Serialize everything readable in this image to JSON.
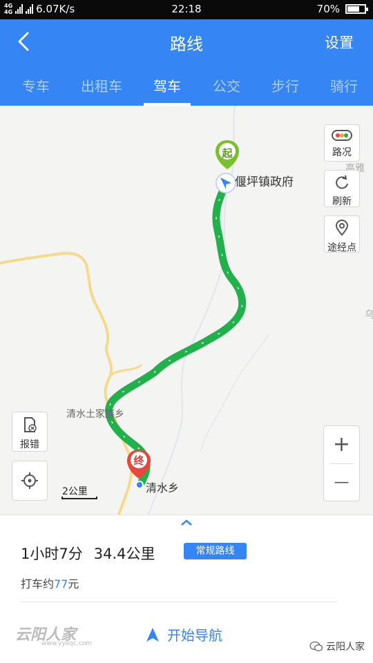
{
  "status_bar": {
    "signal_1": "4G",
    "signal_2": "4G",
    "net_speed": "6.07K/s",
    "time": "22:18",
    "battery": "70%",
    "battery_level": 0.7
  },
  "header": {
    "title": "路线",
    "settings_label": "设置"
  },
  "tabs": [
    {
      "label": "专车",
      "active": false
    },
    {
      "label": "出租车",
      "active": false
    },
    {
      "label": "驾车",
      "active": true
    },
    {
      "label": "公交",
      "active": false
    },
    {
      "label": "步行",
      "active": false
    },
    {
      "label": "骑行",
      "active": false
    }
  ],
  "map": {
    "start_marker": "起",
    "end_marker": "终",
    "start_place": "偃坪镇政府",
    "end_place": "清水乡",
    "village_label": "清水土家族乡",
    "edge_label_1": "高雅乡",
    "edge_label_2": "乌",
    "scale_label": "2公里",
    "controls": {
      "traffic": "路况",
      "refresh": "刷新",
      "waypoint": "途经点",
      "report": "报错"
    },
    "zoom_in": "+",
    "zoom_out": "—",
    "route_color": "#21b04b",
    "road_color": "#f7d98a"
  },
  "summary": {
    "duration": "1小时7分",
    "distance": "34.4公里",
    "route_type": "常规路线",
    "taxi_prefix": "打车约",
    "taxi_price": "77",
    "taxi_suffix": "元",
    "start_nav": "开始导航"
  },
  "watermark": {
    "left_text": "云阳人家",
    "left_url": "www.yyeqc.com",
    "right_text": "云阳人家"
  }
}
